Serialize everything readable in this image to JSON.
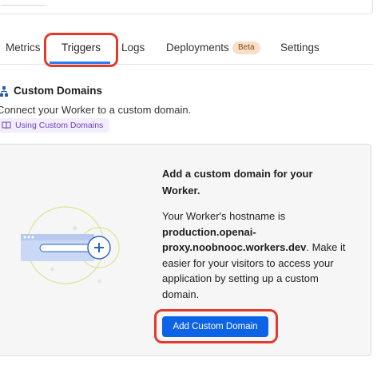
{
  "tabs": [
    {
      "label": "Metrics"
    },
    {
      "label": "Triggers",
      "active": true
    },
    {
      "label": "Logs"
    },
    {
      "label": "Deployments",
      "badge": "Beta"
    },
    {
      "label": "Settings"
    }
  ],
  "section": {
    "icon": "sitemap-icon",
    "title": "Custom Domains",
    "description": "Connect your Worker to a custom domain.",
    "doc_link": {
      "icon": "book-icon",
      "label": "Using Custom Domains"
    }
  },
  "card": {
    "illustration_icon": "plus-icon",
    "title": "Add a custom domain for your Worker.",
    "body_prefix": "Your Worker's hostname is ",
    "hostname": "production.openai-proxy.noobnooc.workers.dev",
    "body_suffix": ". Make it easier for your visitors to access your application by setting up a custom domain.",
    "cta_label": "Add Custom Domain"
  },
  "colors": {
    "accent": "#0d63e6",
    "tab_indicator": "#2c7cf6",
    "annotation": "#e23b2b",
    "beta_bg": "#f8dfc7",
    "link": "#6a3fbf"
  }
}
